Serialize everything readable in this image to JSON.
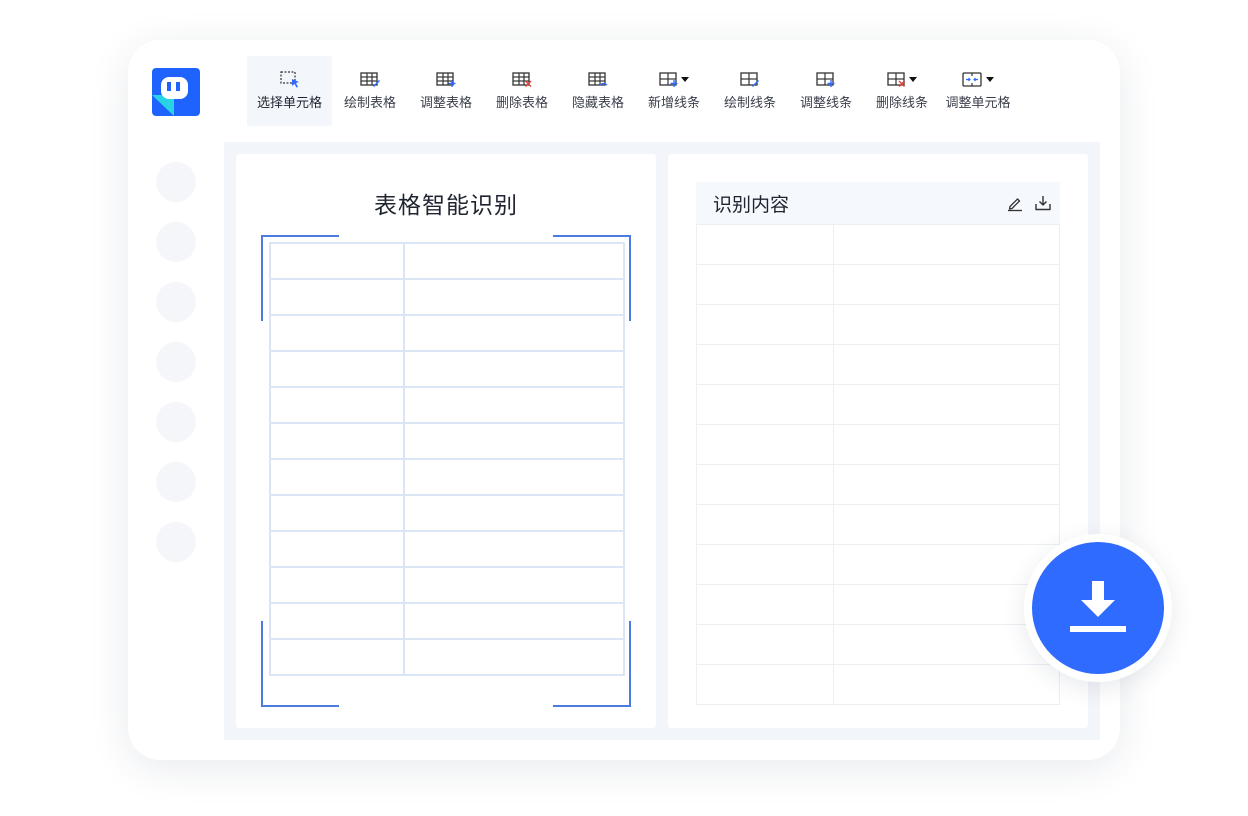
{
  "toolbar": {
    "items": [
      {
        "label": "选择单元格",
        "icon": "select-cell-icon"
      },
      {
        "label": "绘制表格",
        "icon": "draw-table-icon"
      },
      {
        "label": "调整表格",
        "icon": "adjust-table-icon"
      },
      {
        "label": "删除表格",
        "icon": "delete-table-icon"
      },
      {
        "label": "隐藏表格",
        "icon": "hide-table-icon"
      },
      {
        "label": "新增线条",
        "icon": "add-line-icon"
      },
      {
        "label": "绘制线条",
        "icon": "draw-line-icon"
      },
      {
        "label": "调整线条",
        "icon": "adjust-line-icon"
      },
      {
        "label": "删除线条",
        "icon": "delete-line-icon"
      },
      {
        "label": "调整单元格",
        "icon": "adjust-cell-icon"
      }
    ]
  },
  "left_panel": {
    "title": "表格智能识别"
  },
  "right_panel": {
    "title": "识别内容"
  },
  "colors": {
    "accent": "#2f6bff",
    "frame": "#4a7be0",
    "grid": "#dbe5f6",
    "logo_blue": "#1f63ff",
    "logo_cyan": "#29d3e6"
  }
}
